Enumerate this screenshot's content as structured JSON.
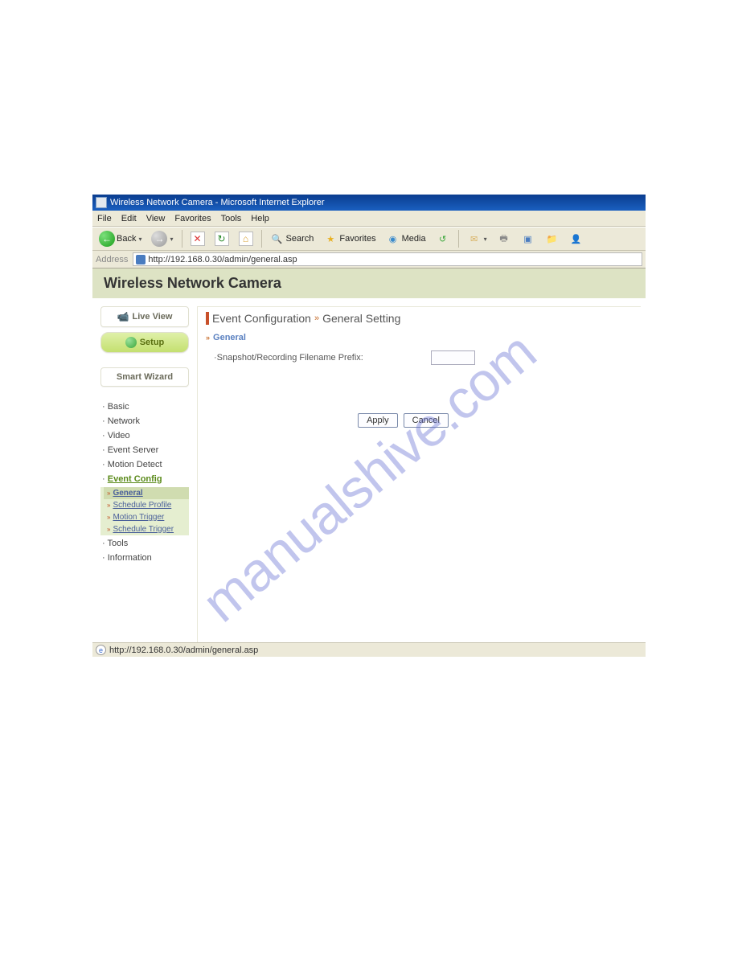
{
  "window_title": "Wireless Network Camera - Microsoft Internet Explorer",
  "menu": {
    "file": "File",
    "edit": "Edit",
    "view": "View",
    "favorites": "Favorites",
    "tools": "Tools",
    "help": "Help"
  },
  "toolbar": {
    "back": "Back",
    "search": "Search",
    "favorites": "Favorites",
    "media": "Media"
  },
  "address_label": "Address",
  "address_url": "http://192.168.0.30/admin/general.asp",
  "page_title": "Wireless Network Camera",
  "sidebar": {
    "live_view": "Live View",
    "setup": "Setup",
    "smart_wizard": "Smart Wizard",
    "items": [
      {
        "label": "Basic"
      },
      {
        "label": "Network"
      },
      {
        "label": "Video"
      },
      {
        "label": "Event Server"
      },
      {
        "label": "Motion Detect"
      },
      {
        "label": "Event Config",
        "active": true,
        "sub": [
          {
            "label": "General",
            "selected": true
          },
          {
            "label": "Schedule Profile"
          },
          {
            "label": "Motion Trigger"
          },
          {
            "label": "Schedule Trigger"
          }
        ]
      },
      {
        "label": "Tools"
      },
      {
        "label": "Information"
      }
    ]
  },
  "main": {
    "title_a": "Event Configuration",
    "title_b": "General Setting",
    "section": "General",
    "field_label": "·Snapshot/Recording Filename Prefix:",
    "field_value": "",
    "apply": "Apply",
    "cancel": "Cancel"
  },
  "status_text": "http://192.168.0.30/admin/general.asp",
  "watermark": "manualshive.com"
}
